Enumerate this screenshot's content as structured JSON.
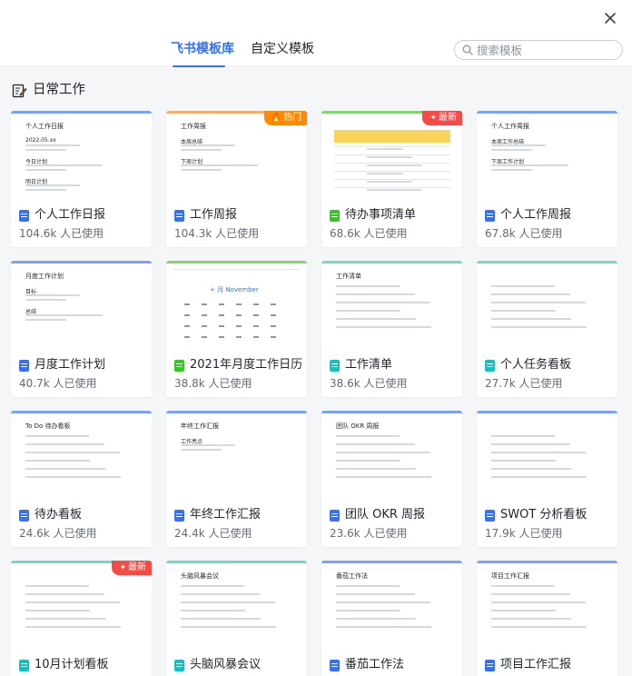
{
  "header": {
    "tabs": [
      {
        "label": "飞书模板库",
        "active": true
      },
      {
        "label": "自定义模板",
        "active": false
      }
    ],
    "search_placeholder": "搜索模板"
  },
  "section": {
    "title": "日常工作",
    "icon": "note-edit-icon"
  },
  "colors": {
    "accent": "#3370ff",
    "doc": "#3370ff",
    "sheet": "#34c724",
    "board": "#14c0c0",
    "hot": "#ff8a00",
    "new": "#f54a45",
    "line_blue": "#7aa2f7",
    "line_green": "#7fd66d",
    "line_teal": "#6fd7d4",
    "line_orange": "#f7ab68"
  },
  "cards": [
    {
      "name": "个人工作日报",
      "usage": "104.6k 人已使用",
      "type": "doc",
      "badge": "",
      "preview_title": "个人工作日报",
      "preview_lines": [
        "2022.05.xx",
        "今日计划",
        "明日计划"
      ]
    },
    {
      "name": "工作周报",
      "usage": "104.3k 人已使用",
      "type": "doc",
      "badge": "热门",
      "preview_title": "工作周报",
      "preview_lines": [
        "本周总结",
        "下周计划"
      ]
    },
    {
      "name": "待办事项清单",
      "usage": "68.6k 人已使用",
      "type": "sheet",
      "badge": "最新",
      "preview_title": "",
      "preview_lines": []
    },
    {
      "name": "个人工作周报",
      "usage": "67.8k 人已使用",
      "type": "doc",
      "badge": "",
      "preview_title": "个人工作周报",
      "preview_lines": [
        "本周工作总结",
        "下周工作计划"
      ]
    },
    {
      "name": "月度工作计划",
      "usage": "40.7k 人已使用",
      "type": "doc",
      "badge": "",
      "preview_title": "月度工作计划",
      "preview_lines": [
        "目标",
        "总结"
      ]
    },
    {
      "name": "2021年月度工作日历",
      "usage": "38.8k 人已使用",
      "type": "sheet",
      "badge": "",
      "preview_title": "+ 月 November",
      "preview_lines": []
    },
    {
      "name": "工作清单",
      "usage": "38.6k 人已使用",
      "type": "board",
      "badge": "",
      "preview_title": "工作清单",
      "preview_lines": []
    },
    {
      "name": "个人任务看板",
      "usage": "27.7k 人已使用",
      "type": "board",
      "badge": "",
      "preview_title": "",
      "preview_lines": []
    },
    {
      "name": "待办看板",
      "usage": "24.6k 人已使用",
      "type": "doc",
      "badge": "",
      "preview_title": "To Do 待办看板",
      "preview_lines": []
    },
    {
      "name": "年终工作汇报",
      "usage": "24.4k 人已使用",
      "type": "doc",
      "badge": "",
      "preview_title": "年终工作汇报",
      "preview_lines": [
        "工作亮点"
      ]
    },
    {
      "name": "团队 OKR 周报",
      "usage": "23.6k 人已使用",
      "type": "doc",
      "badge": "",
      "preview_title": "团队 OKR 周报",
      "preview_lines": []
    },
    {
      "name": "SWOT 分析看板",
      "usage": "17.9k 人已使用",
      "type": "doc",
      "badge": "",
      "preview_title": "",
      "preview_lines": []
    },
    {
      "name": "10月计划看板",
      "usage": "",
      "type": "board",
      "badge": "最新",
      "preview_title": "",
      "preview_lines": []
    },
    {
      "name": "头脑风暴会议",
      "usage": "",
      "type": "board",
      "badge": "",
      "preview_title": "头脑风暴会议",
      "preview_lines": []
    },
    {
      "name": "番茄工作法",
      "usage": "",
      "type": "doc",
      "badge": "",
      "preview_title": "番茄工作法",
      "preview_lines": []
    },
    {
      "name": "项目工作汇报",
      "usage": "",
      "type": "doc",
      "badge": "",
      "preview_title": "项目工作汇报",
      "preview_lines": []
    }
  ]
}
